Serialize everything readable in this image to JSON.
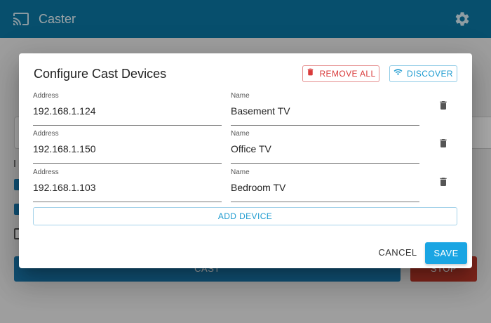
{
  "app": {
    "title": "Caster",
    "icons": {
      "logo": "cast-icon",
      "settings": "gear-icon"
    }
  },
  "background": {
    "cast_label": "CAST",
    "stop_label": "STOP"
  },
  "dialog": {
    "title": "Configure Cast Devices",
    "remove_all_label": "REMOVE ALL",
    "discover_label": "DISCOVER",
    "address_label": "Address",
    "name_label": "Name",
    "devices": [
      {
        "address": "192.168.1.124",
        "name": "Basement TV"
      },
      {
        "address": "192.168.1.150",
        "name": "Office TV"
      },
      {
        "address": "192.168.1.103",
        "name": "Bedroom TV"
      }
    ],
    "add_device_label": "ADD DEVICE",
    "cancel_label": "CANCEL",
    "save_label": "SAVE"
  },
  "colors": {
    "appbar": "#0b77a3",
    "accent": "#1aa5e3",
    "danger": "#d93b3b"
  }
}
